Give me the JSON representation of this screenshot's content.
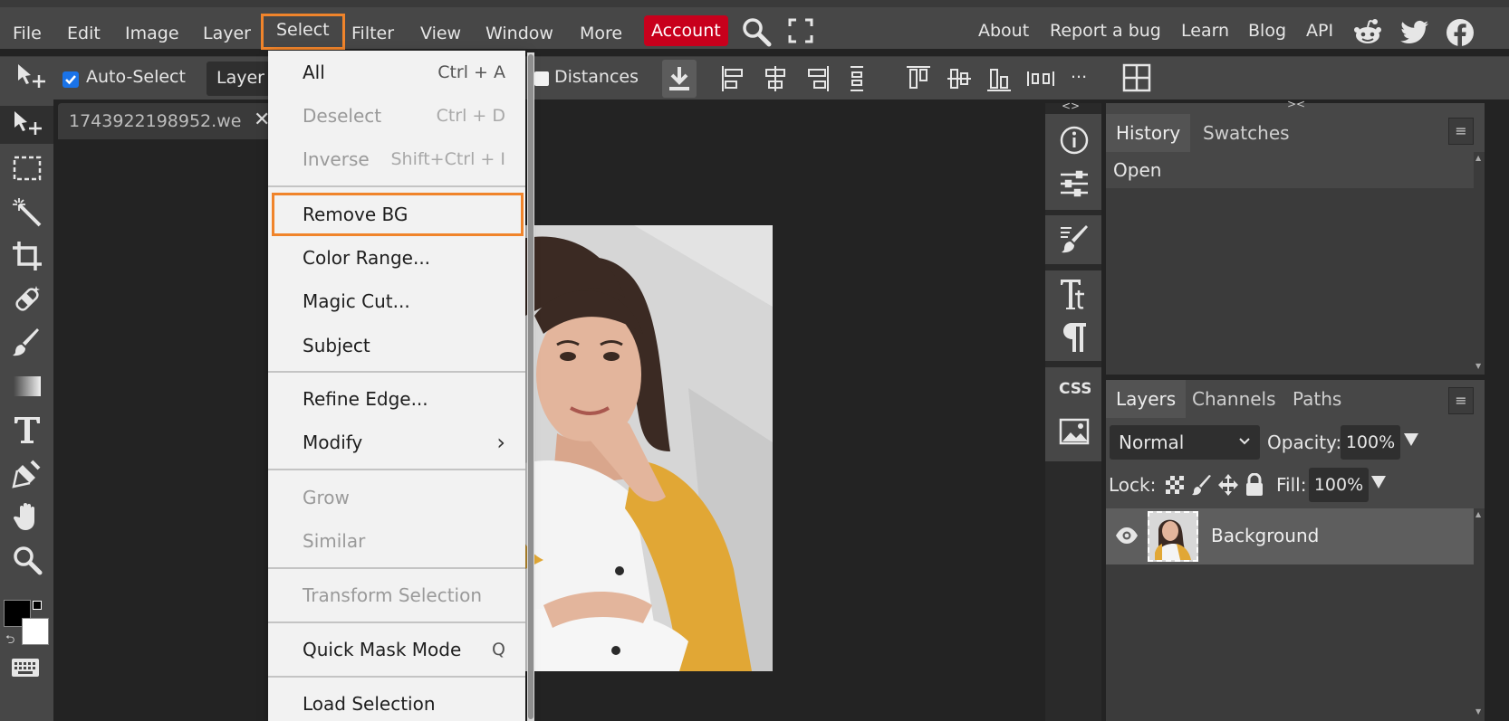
{
  "menubar": {
    "items": [
      "File",
      "Edit",
      "Image",
      "Layer",
      "Select",
      "Filter",
      "View",
      "Window",
      "More"
    ],
    "account": "Account",
    "right": [
      "About",
      "Report a bug",
      "Learn",
      "Blog",
      "API"
    ]
  },
  "options": {
    "auto_select": "Auto-Select",
    "layer_select": "Layer",
    "distances": "Distances",
    "more": "..."
  },
  "document": {
    "tab_name": "1743922198952.we"
  },
  "select_menu": {
    "groups": [
      [
        {
          "label": "All",
          "shortcut": "Ctrl + A",
          "disabled": false
        },
        {
          "label": "Deselect",
          "shortcut": "Ctrl + D",
          "disabled": true
        },
        {
          "label": "Inverse",
          "shortcut": "Shift+Ctrl + I",
          "disabled": true
        }
      ],
      [
        {
          "label": "Remove BG",
          "highlighted": true
        },
        {
          "label": "Color Range..."
        },
        {
          "label": "Magic Cut..."
        },
        {
          "label": "Subject"
        }
      ],
      [
        {
          "label": "Refine Edge..."
        },
        {
          "label": "Modify",
          "submenu": "›"
        }
      ],
      [
        {
          "label": "Grow",
          "disabled": true
        },
        {
          "label": "Similar",
          "disabled": true
        }
      ],
      [
        {
          "label": "Transform Selection",
          "disabled": true
        }
      ],
      [
        {
          "label": "Quick Mask Mode",
          "shortcut": "Q"
        }
      ],
      [
        {
          "label": "Load Selection"
        }
      ]
    ]
  },
  "panels": {
    "collapse_left": "<>",
    "collapse_right": "><",
    "history": {
      "tabs": [
        "History",
        "Swatches"
      ],
      "entries": [
        "Open"
      ]
    },
    "layers": {
      "tabs": [
        "Layers",
        "Channels",
        "Paths"
      ],
      "blend_mode": "Normal",
      "opacity_label": "Opacity:",
      "opacity": "100%",
      "lock_label": "Lock:",
      "fill_label": "Fill:",
      "fill": "100%",
      "layer_name": "Background"
    },
    "menu_glyph": "≡"
  },
  "colors": {
    "accent": "#f0842b",
    "account": "#c8001c",
    "chrome": "#474747",
    "workspace": "#232323"
  }
}
